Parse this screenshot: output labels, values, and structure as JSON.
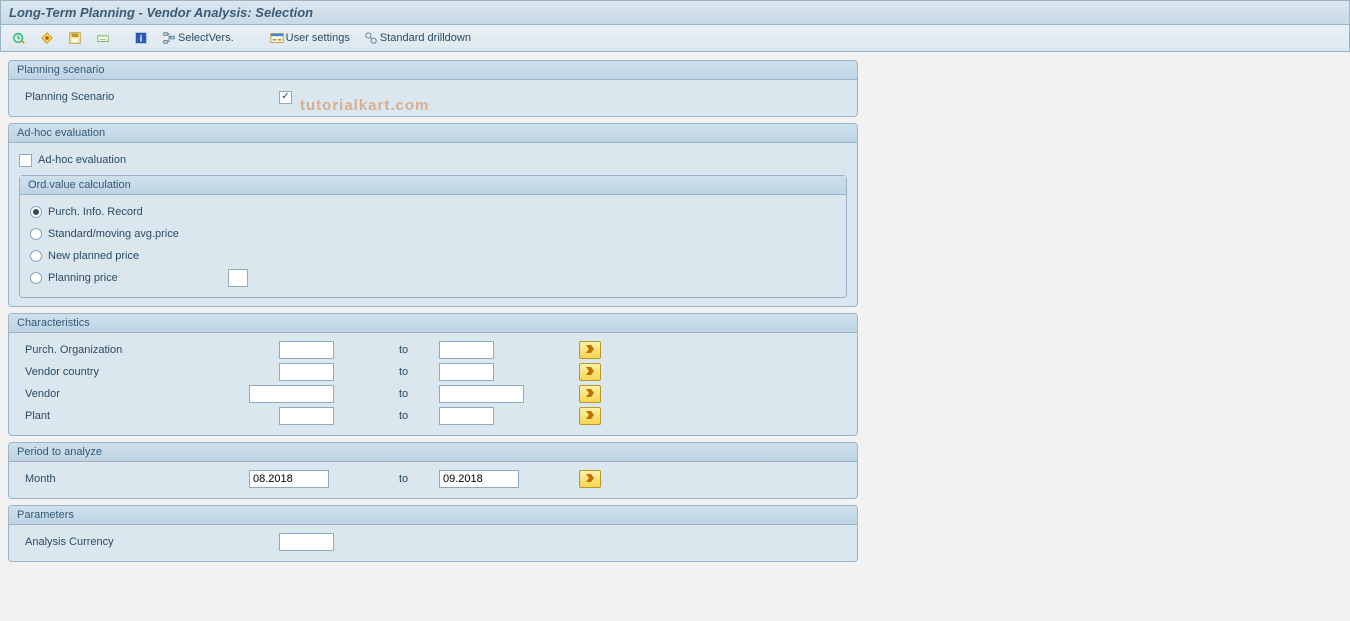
{
  "title": "Long-Term Planning - Vendor Analysis: Selection",
  "watermark": "tutorialkart.com",
  "toolbar": {
    "execute_icon": "execute",
    "variant_icon": "variant",
    "save_icon": "save",
    "display_icon": "display",
    "info_icon": "info",
    "tree_icon": "tree",
    "selectvers_label": "SelectVers.",
    "usersettings_icon": "user-settings",
    "usersettings_label": "User settings",
    "drilldown_icon": "drilldown",
    "drilldown_label": "Standard drilldown"
  },
  "groups": {
    "planning": {
      "title": "Planning scenario",
      "field_label": "Planning Scenario"
    },
    "adhoc": {
      "title": "Ad-hoc evaluation",
      "chk_label": "Ad-hoc evaluation",
      "sub_title": "Ord.value calculation",
      "opt1": "Purch. Info. Record",
      "opt2": "Standard/moving avg.price",
      "opt3": "New planned price",
      "opt4": "Planning price"
    },
    "chars": {
      "title": "Characteristics",
      "purch_org": "Purch. Organization",
      "vendor_country": "Vendor country",
      "vendor": "Vendor",
      "plant": "Plant",
      "to": "to"
    },
    "period": {
      "title": "Period to analyze",
      "month": "Month",
      "to": "to",
      "from_val": "08.2018",
      "to_val": "09.2018"
    },
    "params": {
      "title": "Parameters",
      "currency": "Analysis Currency"
    }
  }
}
